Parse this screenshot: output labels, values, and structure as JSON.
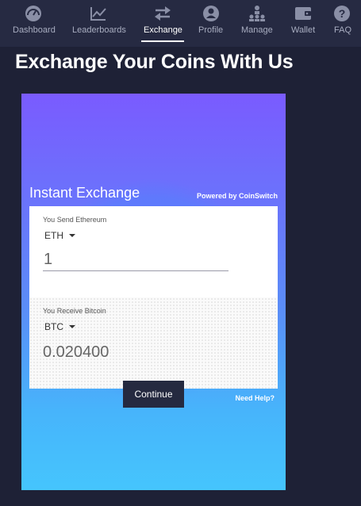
{
  "nav": {
    "items": [
      {
        "label": "Dashboard",
        "icon": "speedometer-icon"
      },
      {
        "label": "Leaderboards",
        "icon": "line-chart-icon"
      },
      {
        "label": "Exchange",
        "icon": "exchange-arrows-icon",
        "active": true
      },
      {
        "label": "Profile",
        "icon": "user-icon"
      },
      {
        "label": "Manage",
        "icon": "hierarchy-icon"
      },
      {
        "label": "Wallet",
        "icon": "wallet-icon"
      },
      {
        "label": "FAQ",
        "icon": "question-icon"
      }
    ]
  },
  "page": {
    "title": "Exchange Your Coins With Us"
  },
  "widget": {
    "title": "Instant Exchange",
    "powered_by": "Powered by CoinSwitch",
    "send": {
      "label": "You Send Ethereum",
      "coin": "ETH",
      "amount": "1"
    },
    "receive": {
      "label": "You Receive Bitcoin",
      "coin": "BTC",
      "amount": "0.020400"
    },
    "continue_label": "Continue",
    "help_label": "Need Help?"
  },
  "colors": {
    "background": "#1e2136",
    "nav_background": "#262a42",
    "nav_icon": "#8a8fa6",
    "gradient_top": "#7a5bff",
    "gradient_bottom": "#45c5fd",
    "button": "#252a40"
  }
}
